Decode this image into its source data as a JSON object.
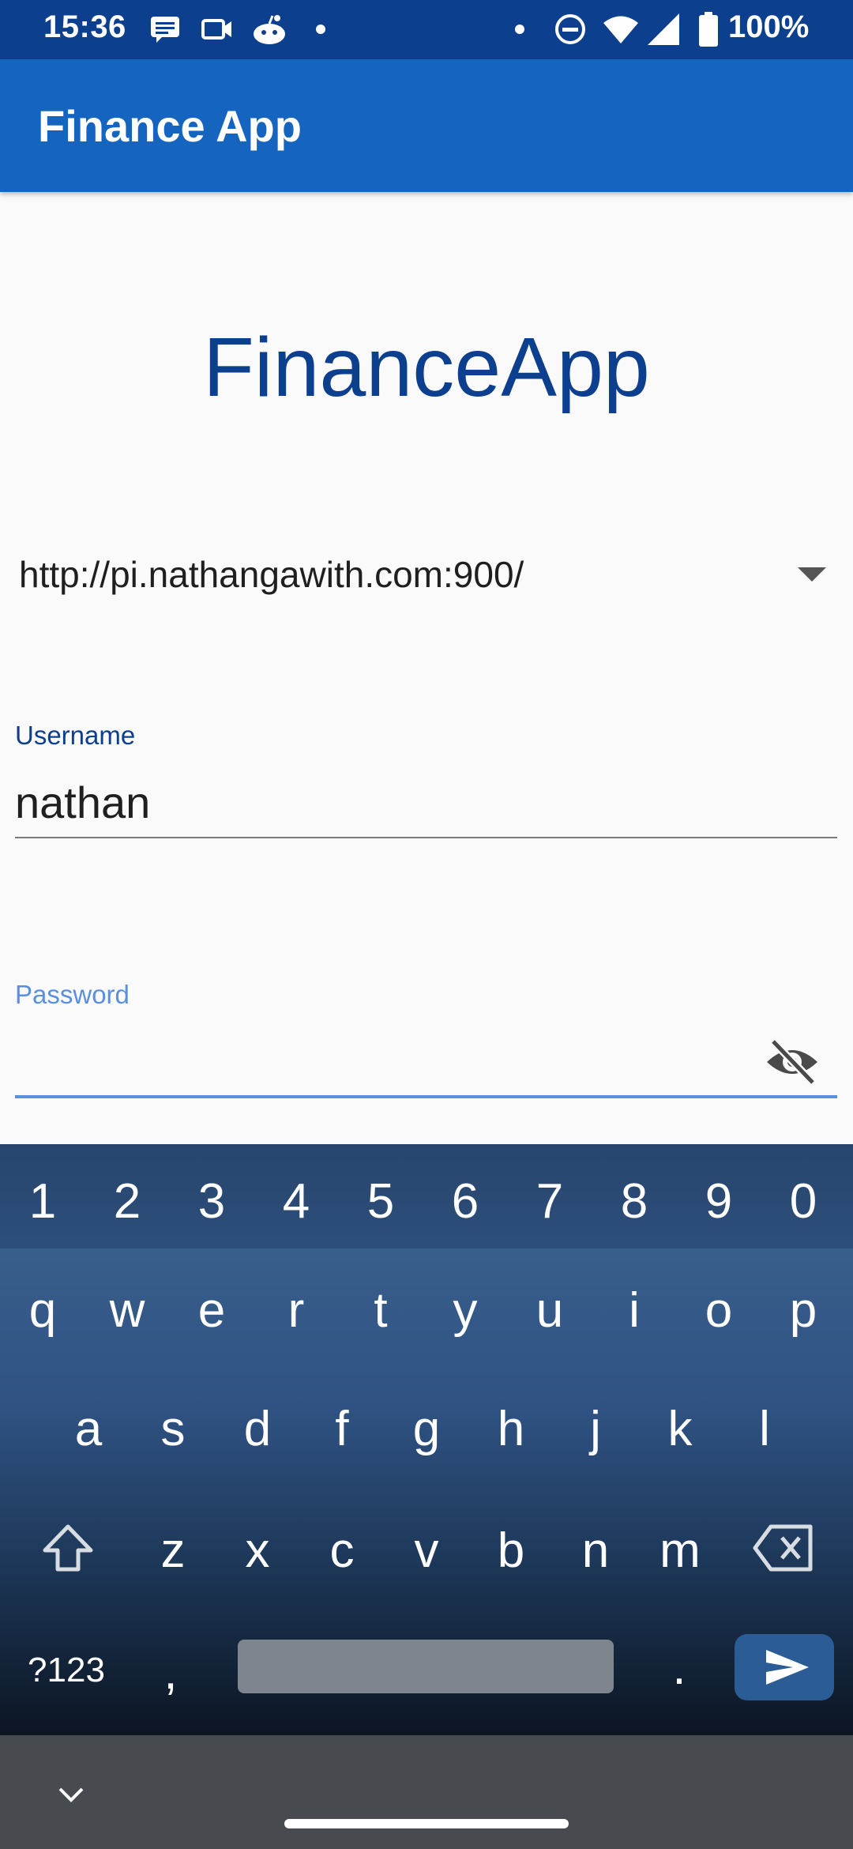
{
  "status_bar": {
    "time": "15:36",
    "battery_percent": "100%",
    "icons": [
      "message-icon",
      "video-icon",
      "reddit-icon",
      "dot-icon",
      "dot-icon",
      "dnd-icon",
      "wifi-icon",
      "signal-icon",
      "battery-icon"
    ]
  },
  "app_bar": {
    "title": "Finance App"
  },
  "brand": {
    "title": "FinanceApp"
  },
  "server": {
    "selected": "http://pi.nathangawith.com:900/"
  },
  "username": {
    "label": "Username",
    "value": "nathan"
  },
  "password": {
    "label": "Password",
    "value": ""
  },
  "keyboard": {
    "numbers": [
      "1",
      "2",
      "3",
      "4",
      "5",
      "6",
      "7",
      "8",
      "9",
      "0"
    ],
    "row1": [
      "q",
      "w",
      "e",
      "r",
      "t",
      "y",
      "u",
      "i",
      "o",
      "p"
    ],
    "row2": [
      "a",
      "s",
      "d",
      "f",
      "g",
      "h",
      "j",
      "k",
      "l"
    ],
    "row3": [
      "z",
      "x",
      "c",
      "v",
      "b",
      "n",
      "m"
    ],
    "symbols_key": "?123",
    "comma_key": ",",
    "period_key": "."
  },
  "colors": {
    "status_bar": "#0d3f8f",
    "app_bar": "#1565c0",
    "brand_text": "#0d3f8f",
    "focus_accent": "#5b8fe0"
  }
}
